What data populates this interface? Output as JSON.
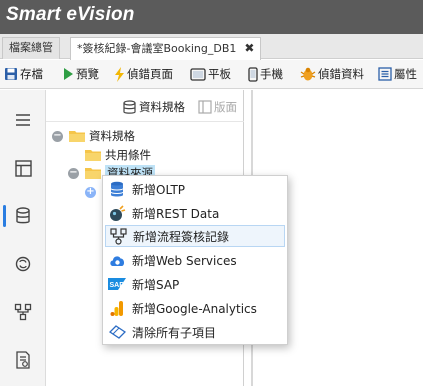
{
  "app": {
    "title": "Smart eVision"
  },
  "tabs": [
    {
      "label": "檔案總管"
    },
    {
      "label": "*簽核紀錄-會議室Booking_DB1",
      "close": "✖"
    }
  ],
  "toolbar": {
    "save": "存檔",
    "preview": "預覽",
    "debug_page": "偵錯頁面",
    "tablet": "平板",
    "phone": "手機",
    "debug_data": "偵錯資料",
    "properties": "屬性"
  },
  "panel": {
    "data_spec_button": "資料規格",
    "layout_button": "版面"
  },
  "tree": {
    "root": "資料規格",
    "shared": "共用條件",
    "source": "資料來源"
  },
  "context_menu": {
    "items": [
      {
        "label": "新增OLTP",
        "icon": "database-icon"
      },
      {
        "label": "新增REST Data",
        "icon": "rest-data-icon"
      },
      {
        "label": "新增流程簽核記錄",
        "icon": "workflow-icon"
      },
      {
        "label": "新增Web Services",
        "icon": "cloud-icon"
      },
      {
        "label": "新增SAP",
        "icon": "sap-icon"
      },
      {
        "label": "新增Google-Analytics",
        "icon": "analytics-icon"
      },
      {
        "label": "清除所有子項目",
        "icon": "eraser-icon"
      }
    ],
    "hovered_index": 2
  },
  "colors": {
    "title_bg": "#5b5b5b",
    "accent": "#2a7de1",
    "selection": "#bfe3f7",
    "folder": "#f5c54a"
  }
}
